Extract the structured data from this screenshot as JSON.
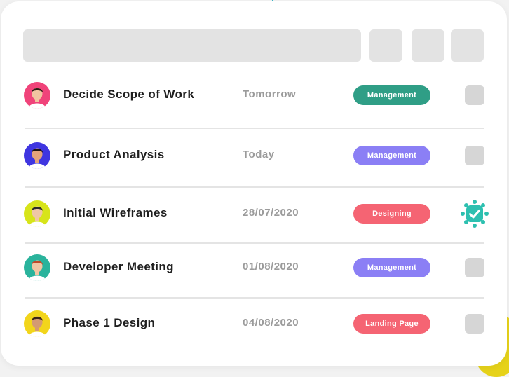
{
  "tasks": [
    {
      "title": "Decide Scope of Work",
      "date": "Tomorrow",
      "tag": "Management",
      "tag_color": "#2f9e86",
      "done": false,
      "avatar_bg": "#f0437a",
      "skin": "#f1c3a1",
      "hair": "#2a1a12"
    },
    {
      "title": "Product Analysis",
      "date": "Today",
      "tag": "Management",
      "tag_color": "#8b7ff5",
      "done": false,
      "avatar_bg": "#3f35e0",
      "skin": "#e4a27b",
      "hair": "#1e1410"
    },
    {
      "title": "Initial Wireframes",
      "date": "28/07/2020",
      "tag": "Designing",
      "tag_color": "#f56473",
      "done": true,
      "avatar_bg": "#d7e41a",
      "skin": "#efc7a6",
      "hair": "#2b2b2b"
    },
    {
      "title": "Developer Meeting",
      "date": "01/08/2020",
      "tag": "Management",
      "tag_color": "#8b7ff5",
      "done": false,
      "avatar_bg": "#2ab39c",
      "skin": "#f3c6a4",
      "hair": "#c24a2a"
    },
    {
      "title": "Phase 1 Design",
      "date": "04/08/2020",
      "tag": "Landing Page",
      "tag_color": "#f56473",
      "done": false,
      "avatar_bg": "#f2d51b",
      "skin": "#d49a72",
      "hair": "#3a2418"
    }
  ],
  "colors": {
    "check_done": "#2dc0b0",
    "check_empty": "#d6d6d6",
    "placeholder": "#e3e3e3"
  },
  "icons": {
    "check_done": "checkmark-badge-icon",
    "check_empty": "empty-checkbox-icon",
    "avatar": "person-avatar-icon"
  }
}
